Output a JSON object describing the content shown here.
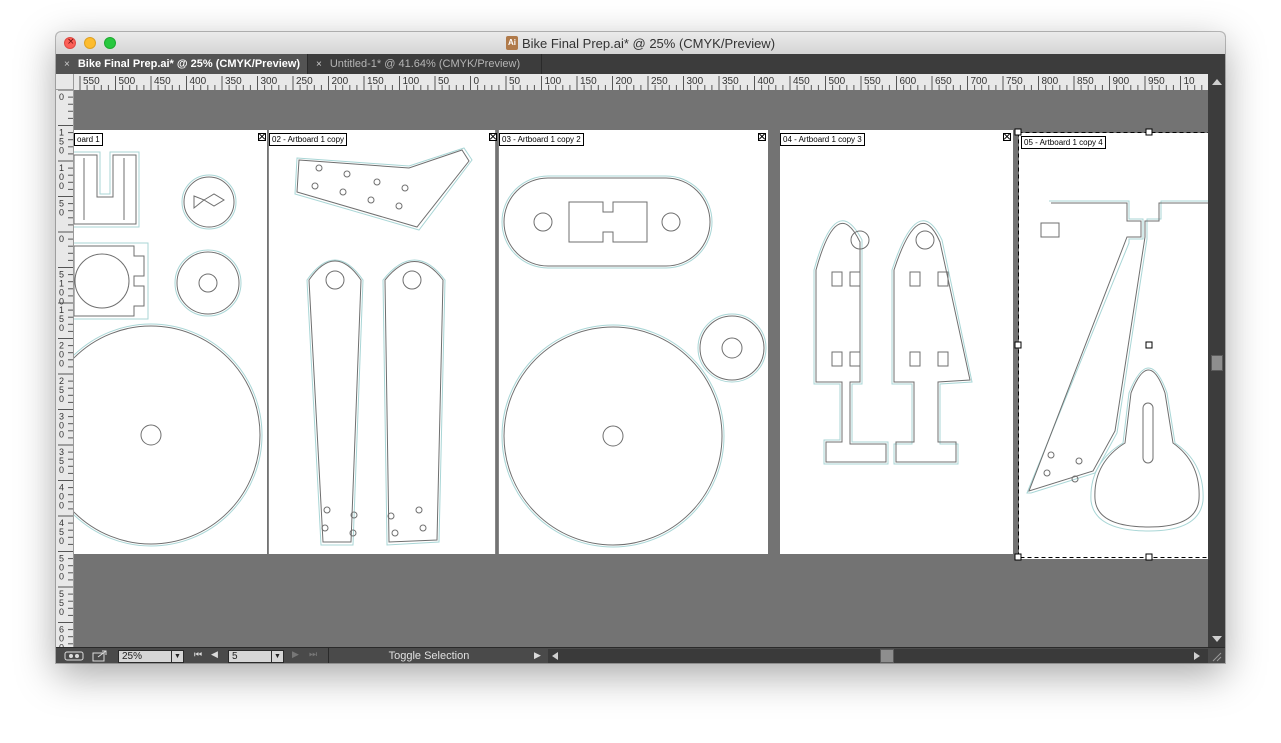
{
  "window": {
    "title": "Bike Final Prep.ai* @ 25% (CMYK/Preview)",
    "doc_icon_glyph": "Ai"
  },
  "tabs": [
    {
      "label": "Bike Final Prep.ai* @ 25% (CMYK/Preview)",
      "active": true
    },
    {
      "label": "Untitled-1* @ 41.64% (CMYK/Preview)",
      "active": false
    }
  ],
  "rulers": {
    "horizontal_ticks": [
      "550",
      "500",
      "450",
      "400",
      "350",
      "300",
      "250",
      "200",
      "150",
      "100",
      "50",
      "0",
      "50",
      "100",
      "150",
      "200",
      "250",
      "300",
      "350",
      "400",
      "450",
      "500",
      "550",
      "600",
      "650",
      "700",
      "750",
      "800",
      "850",
      "900",
      "950",
      "10"
    ],
    "vertical_ticks": [
      "0",
      "150",
      "100",
      "50",
      "0",
      "5100",
      "150",
      "200",
      "250",
      "300",
      "350",
      "400",
      "450",
      "500",
      "550",
      "600"
    ]
  },
  "artboards": [
    {
      "label": "oard 1"
    },
    {
      "label": "02 - Artboard 1 copy"
    },
    {
      "label": "03 - Artboard 1 copy 2"
    },
    {
      "label": "04 - Artboard 1 copy 3"
    },
    {
      "label": "05 - Artboard 1 copy 4"
    }
  ],
  "statusbar": {
    "zoom": "25%",
    "artboard_number": "5",
    "status_text": "Toggle Selection"
  },
  "icons": {
    "close_tab": "×",
    "first": "⏮",
    "prev": "◀",
    "next": "▶",
    "last": "⏭",
    "dropdown": "▼"
  }
}
